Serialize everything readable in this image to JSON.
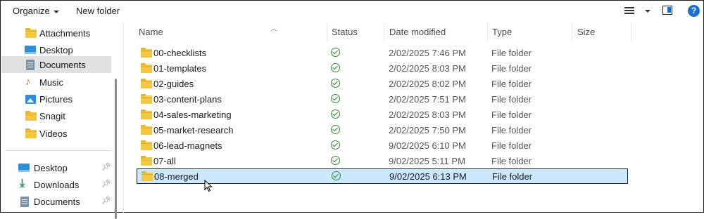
{
  "toolbar": {
    "organize": "Organize",
    "new_folder": "New folder"
  },
  "nav": {
    "items": [
      {
        "label": "Attachments",
        "icon": "folder-icon"
      },
      {
        "label": "Desktop",
        "icon": "desktop-icon"
      },
      {
        "label": "Documents",
        "icon": "documents-icon",
        "selected": true
      },
      {
        "label": "Music",
        "icon": "music-icon"
      },
      {
        "label": "Pictures",
        "icon": "pictures-icon"
      },
      {
        "label": "Snagit",
        "icon": "folder-icon"
      },
      {
        "label": "Videos",
        "icon": "folder-icon"
      }
    ],
    "pinned": [
      {
        "label": "Desktop",
        "icon": "desktop-icon"
      },
      {
        "label": "Downloads",
        "icon": "downloads-icon"
      },
      {
        "label": "Documents",
        "icon": "documents-icon"
      }
    ]
  },
  "columns": {
    "name": "Name",
    "status": "Status",
    "date": "Date modified",
    "type": "Type",
    "size": "Size"
  },
  "files": [
    {
      "name": "00-checklists",
      "date": "2/02/2025 7:46 PM",
      "type": "File folder"
    },
    {
      "name": "01-templates",
      "date": "2/02/2025 8:03 PM",
      "type": "File folder"
    },
    {
      "name": "02-guides",
      "date": "2/02/2025 8:02 PM",
      "type": "File folder"
    },
    {
      "name": "03-content-plans",
      "date": "2/02/2025 7:51 PM",
      "type": "File folder"
    },
    {
      "name": "04-sales-marketing",
      "date": "2/02/2025 8:03 PM",
      "type": "File folder"
    },
    {
      "name": "05-market-research",
      "date": "2/02/2025 7:50 PM",
      "type": "File folder"
    },
    {
      "name": "06-lead-magnets",
      "date": "9/02/2025 6:10 PM",
      "type": "File folder"
    },
    {
      "name": "07-all",
      "date": "9/02/2025 5:11 PM",
      "type": "File folder"
    },
    {
      "name": "08-merged",
      "date": "9/02/2025 6:13 PM",
      "type": "File folder",
      "selected": true
    }
  ],
  "colors": {
    "selection": "#cce8ff",
    "nav_selected": "#e1e1e1",
    "accent": "#1a6fcf",
    "folder": "#f2c744",
    "status_ok": "#2e8b2e"
  }
}
